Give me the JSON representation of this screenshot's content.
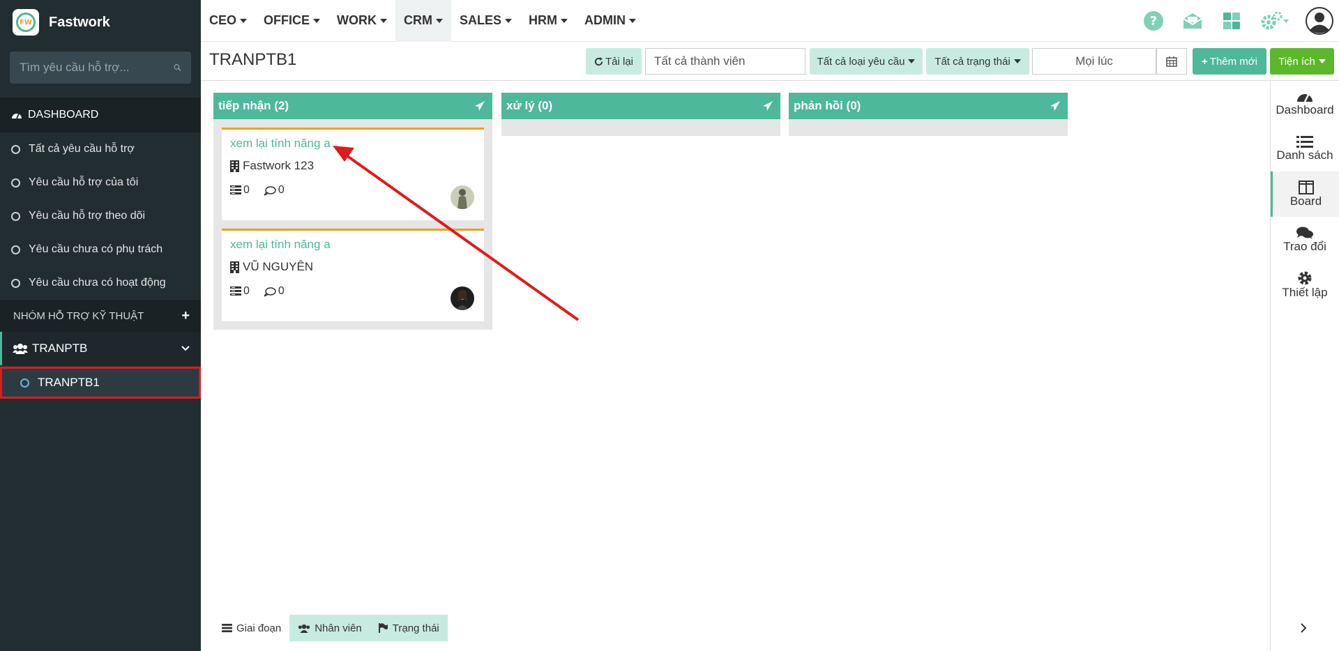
{
  "app": {
    "name": "Fastwork",
    "logo_text": "FW"
  },
  "sidebar": {
    "search_placeholder": "Tìm yêu cầu hỗ trợ...",
    "dashboard_label": "DASHBOARD",
    "items": [
      {
        "label": "Tất cả yêu cầu hỗ trợ"
      },
      {
        "label": "Yêu cầu hỗ trợ của tôi"
      },
      {
        "label": "Yêu cầu hỗ trợ theo dõi"
      },
      {
        "label": "Yêu cầu chưa có phụ trách"
      },
      {
        "label": "Yêu cầu chưa có hoạt động"
      }
    ],
    "group_header": "NHÓM HỖ TRỢ KỸ THUẬT",
    "team": {
      "label": "TRANPTB"
    },
    "sub_team": {
      "label": "TRANPTB1"
    }
  },
  "topnav": {
    "menus": [
      {
        "label": "CEO"
      },
      {
        "label": "OFFICE"
      },
      {
        "label": "WORK"
      },
      {
        "label": "CRM"
      },
      {
        "label": "SALES"
      },
      {
        "label": "HRM"
      },
      {
        "label": "ADMIN"
      }
    ],
    "icons": [
      "help-icon",
      "mail-icon",
      "apps-grid-icon",
      "settings-gears-icon",
      "user-avatar-icon"
    ]
  },
  "toolbar": {
    "title": "TRANPTB1",
    "reload_label": "Tải lại",
    "member_filter": "Tất cả thành viên",
    "type_filter": "Tất cả loại yêu cầu",
    "status_filter": "Tất cả trạng thái",
    "time_filter": "Mọi lúc",
    "add_label": "Thêm mới",
    "utility_label": "Tiện ích"
  },
  "board": {
    "columns": [
      {
        "title": "tiếp nhận (2)",
        "cards": [
          {
            "title": "xem lại tính năng a",
            "customer": "Fastwork 123",
            "tasks": "0",
            "comments": "0"
          },
          {
            "title": "xem lại tính năng a",
            "customer": "VŨ NGUYÊN",
            "tasks": "0",
            "comments": "0"
          }
        ]
      },
      {
        "title": "xử lý (0)",
        "cards": []
      },
      {
        "title": "phản hồi (0)",
        "cards": []
      }
    ]
  },
  "right_panel": {
    "items": [
      {
        "label": "Dashboard"
      },
      {
        "label": "Danh sách"
      },
      {
        "label": "Board"
      },
      {
        "label": "Trao đổi"
      },
      {
        "label": "Thiết lập"
      }
    ]
  },
  "bottom_tabs": [
    {
      "label": "Giai đoạn"
    },
    {
      "label": "Nhân viên"
    },
    {
      "label": "Trạng thái"
    }
  ],
  "colors": {
    "accent": "#4db89a",
    "sidebar_bg": "#222d32",
    "card_border": "#e8a31c",
    "highlight": "#e01b1b",
    "lime": "#5cb82b"
  }
}
